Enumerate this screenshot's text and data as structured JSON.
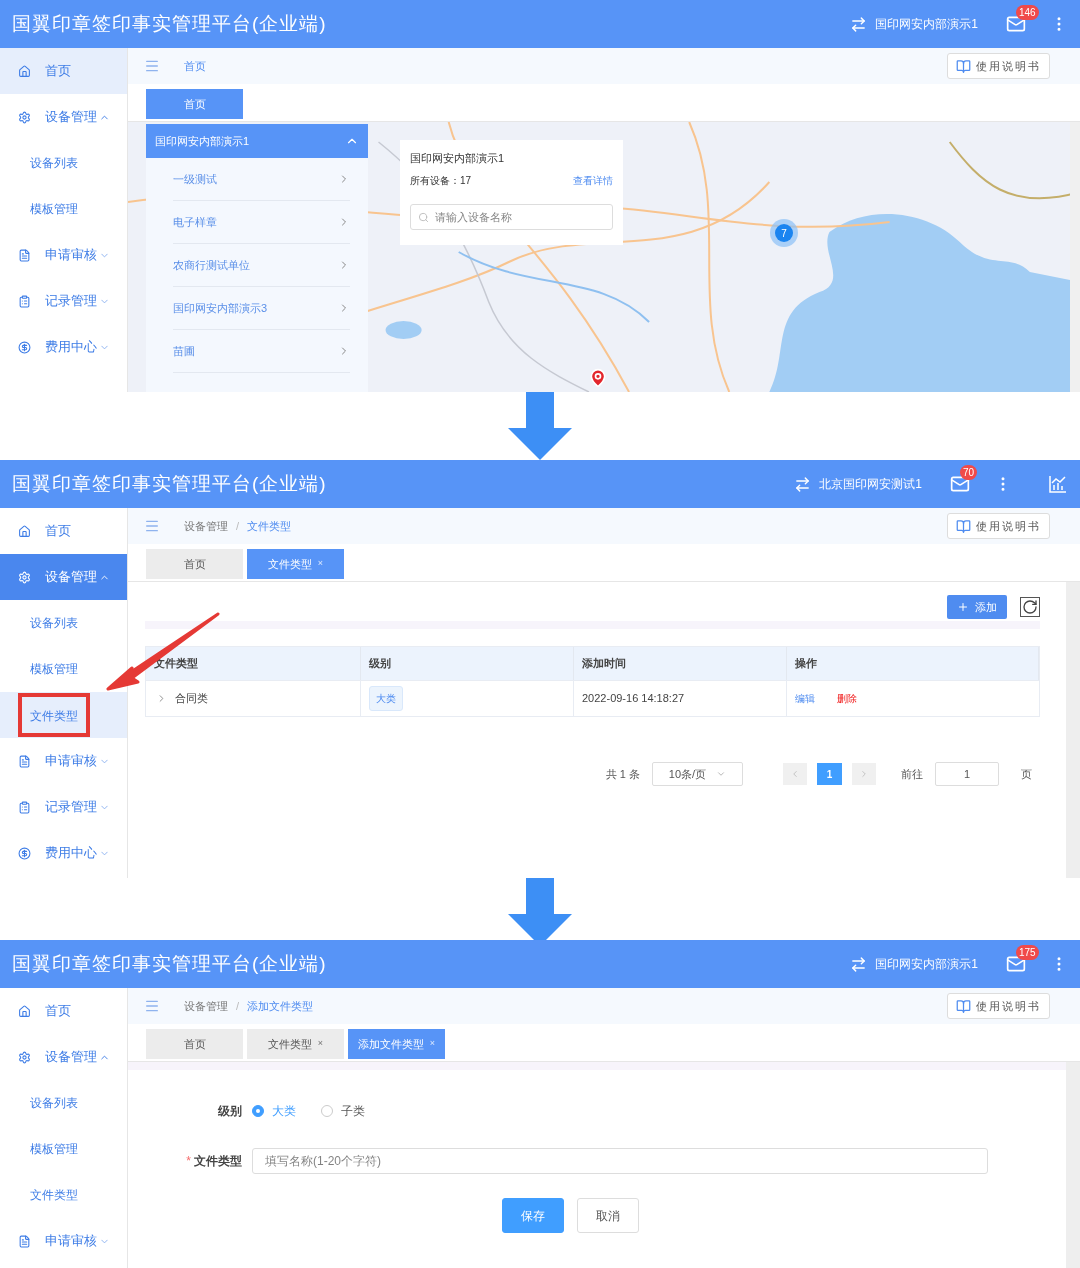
{
  "screens": [
    {
      "header": {
        "title": "国翼印章签印事实管理平台(企业端)",
        "account": "国印网安内部演示1",
        "mail_count": "146"
      },
      "sidebar": [
        {
          "label": "首页",
          "selected": true
        },
        {
          "label": "设备管理",
          "selected": false,
          "expanded": true,
          "children": [
            {
              "label": "设备列表",
              "selected": false
            },
            {
              "label": "模板管理",
              "selected": false
            }
          ]
        },
        {
          "label": "申请审核",
          "selected": false,
          "expanded": false
        },
        {
          "label": "记录管理",
          "selected": false,
          "expanded": false
        },
        {
          "label": "费用中心",
          "selected": false,
          "expanded": false
        }
      ],
      "breadcrumb": [
        "首页"
      ],
      "manual_button": "使用说明书",
      "tabs": [
        {
          "label": "首页",
          "selected": true
        }
      ],
      "content": {
        "kind": "map",
        "tree": {
          "title": "国印网安内部演示1",
          "expanded": true,
          "items": [
            "一级测试",
            "电子样章",
            "农商行测试单位",
            "国印网安内部演示3",
            "苗圃"
          ]
        },
        "info": {
          "title": "国印网安内部演示1",
          "count_label": "所有设备：17",
          "link": "查看详情",
          "search_placeholder": "请输入设备名称"
        },
        "cluster": "7"
      }
    },
    {
      "header": {
        "title": "国翼印章签印事实管理平台(企业端)",
        "account": "北京国印网安测试1",
        "mail_count": "70",
        "stats_button": true
      },
      "sidebar": [
        {
          "label": "首页",
          "selected": false
        },
        {
          "label": "设备管理",
          "selected": true,
          "expanded": true,
          "children": [
            {
              "label": "设备列表",
              "selected": false
            },
            {
              "label": "模板管理",
              "selected": false
            },
            {
              "label": "文件类型",
              "selected": true,
              "highlighted": true
            }
          ]
        },
        {
          "label": "申请审核",
          "selected": false,
          "expanded": false
        },
        {
          "label": "记录管理",
          "selected": false,
          "expanded": false
        },
        {
          "label": "费用中心",
          "selected": false,
          "expanded": false
        }
      ],
      "breadcrumb": [
        "设备管理",
        "文件类型"
      ],
      "breadcrumb_separator": "/",
      "manual_button": "使用说明书",
      "tabs": [
        {
          "label": "首页",
          "selected": false
        },
        {
          "label": "文件类型",
          "selected": true,
          "close": "×"
        }
      ],
      "content": {
        "kind": "table",
        "add_button": "添加",
        "columns": [
          "文件类型",
          "级别",
          "添加时间",
          "操作"
        ],
        "rows": [
          {
            "expandable": true,
            "name": "合同类",
            "level": "大类",
            "time": "2022-09-16 14:18:27",
            "actions": [
              {
                "label": "编辑",
                "kind": "edit"
              },
              {
                "label": "删除",
                "kind": "delete"
              }
            ]
          }
        ],
        "pagination": {
          "total": "共 1 条",
          "page_size": "10条/页",
          "pages": [
            {
              "label": "1",
              "selected": true
            }
          ],
          "goto_label": "前往",
          "goto_value": "1",
          "page_suffix": "页"
        }
      }
    },
    {
      "header": {
        "title": "国翼印章签印事实管理平台(企业端)",
        "account": "国印网安内部演示1",
        "mail_count": "175"
      },
      "sidebar": [
        {
          "label": "首页",
          "selected": false
        },
        {
          "label": "设备管理",
          "selected": false,
          "expanded": true,
          "children": [
            {
              "label": "设备列表",
              "selected": false
            },
            {
              "label": "模板管理",
              "selected": false
            },
            {
              "label": "文件类型",
              "selected": false
            }
          ]
        },
        {
          "label": "申请审核",
          "selected": false,
          "expanded": false
        }
      ],
      "breadcrumb": [
        "设备管理",
        "添加文件类型"
      ],
      "breadcrumb_separator": "/",
      "manual_button": "使用说明书",
      "tabs": [
        {
          "label": "首页",
          "selected": false
        },
        {
          "label": "文件类型",
          "selected": false,
          "close": "×"
        },
        {
          "label": "添加文件类型",
          "selected": true,
          "close": "×"
        }
      ],
      "content": {
        "kind": "form",
        "required_mark": "*",
        "fields": [
          {
            "kind": "radio",
            "label": "级别",
            "required": false,
            "options": [
              {
                "label": "大类",
                "selected": true
              },
              {
                "label": "子类",
                "selected": false
              }
            ]
          },
          {
            "kind": "text",
            "label": "文件类型",
            "required": true,
            "placeholder": "填写名称(1-20个字符)"
          }
        ],
        "buttons": [
          {
            "label": "保存",
            "kind": "primary"
          },
          {
            "label": "取消",
            "kind": "default"
          }
        ]
      }
    }
  ]
}
